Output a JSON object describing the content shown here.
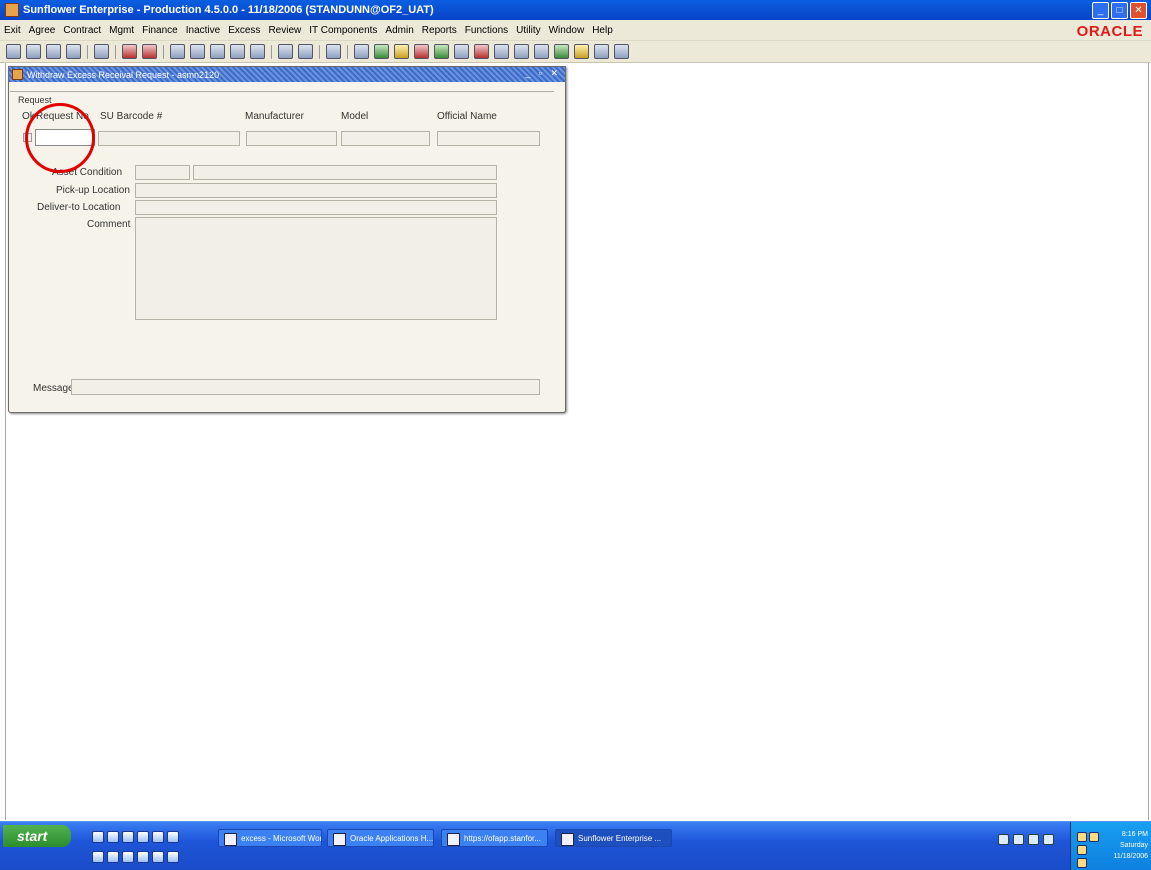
{
  "app": {
    "title": "Sunflower Enterprise - Production 4.5.0.0 - 11/18/2006 (STANDUNN@OF2_UAT)",
    "brand": "ORACLE"
  },
  "menu": [
    "Exit",
    "Agree",
    "Contract",
    "Mgmt",
    "Finance",
    "Inactive",
    "Excess",
    "Review",
    "IT Components",
    "Admin",
    "Reports",
    "Functions",
    "Utility",
    "Window",
    "Help"
  ],
  "form": {
    "title": "Withdraw Excess Receival Request - asmn2120",
    "group_label": "Request",
    "col_ok": "Ok",
    "col_request_no": "Request No",
    "col_su_barcode": "SU Barcode #",
    "col_manufacturer": "Manufacturer",
    "col_model": "Model",
    "col_official_name": "Official Name",
    "lbl_asset_condition": "Asset Condition",
    "lbl_pickup": "Pick-up Location",
    "lbl_deliver": "Deliver-to Location",
    "lbl_comment": "Comment",
    "lbl_message": "Message"
  },
  "taskbar": {
    "start": "start",
    "tasks": [
      "excess - Microsoft Word",
      "Oracle Applications H...",
      "https://ofapp.stanfor...",
      "Sunflower Enterprise ..."
    ],
    "time": "8:16 PM",
    "day": "Saturday",
    "date": "11/18/2006"
  },
  "colors": {
    "highlight_circle": "#e20000",
    "titlebar": "#0a5fe0",
    "oracle_red": "#e01a1a"
  }
}
